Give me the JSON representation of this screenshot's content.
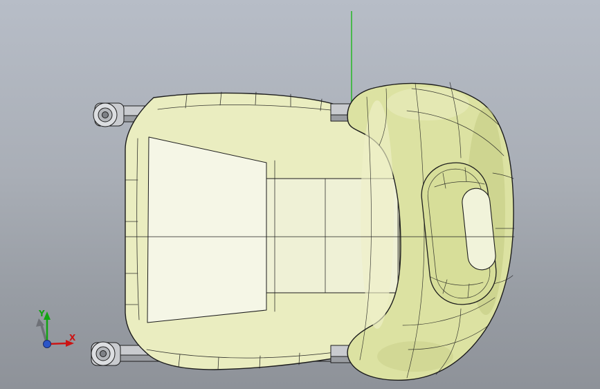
{
  "viewport": {
    "background_top": "#b7bdc7",
    "background_bottom": "#8e9299",
    "datum_line_color": "#2fb82f"
  },
  "triad": {
    "y_label": "Y",
    "x_label": "X",
    "y_color": "#11a511",
    "x_color": "#cc1414",
    "z_dot_color": "#2b55c8",
    "shadow_arrow_color": "#6e7177"
  },
  "model": {
    "edge_color": "#1c1c1c",
    "cushion_fill": "#eaedc0",
    "panel_fill": "#f5f6e6",
    "channel_fill": "#eff1d6",
    "backrest_fill": "#dce2a2",
    "backrest_shadow": "#c3ca81",
    "backrest_highlight": "#eef0c8",
    "ring_fill": "#d7de99",
    "ring_hole_fill": "#f1f3da",
    "rail_fill": "#c9cbcf",
    "rail_dark": "#9a9da2",
    "rail_knob_fill": "#dcdee1"
  }
}
